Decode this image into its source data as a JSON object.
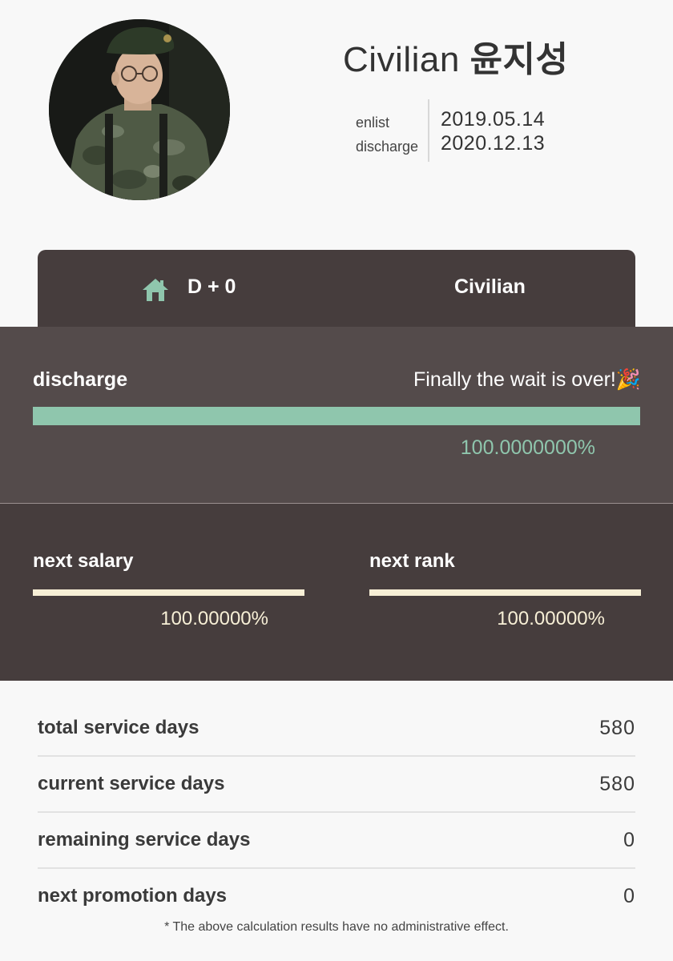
{
  "profile": {
    "name_prefix": "Civilian",
    "name_korean": "윤지성",
    "enlist_label": "enlist",
    "discharge_label": "discharge",
    "enlist_date": "2019.05.14",
    "discharge_date": "2020.12.13"
  },
  "dday": {
    "icon": "home-icon",
    "text": "D + 0",
    "status": "Civilian"
  },
  "discharge_progress": {
    "label": "discharge",
    "message": "Finally the wait is over!🎉",
    "percent_text": "100.0000000%",
    "fraction": 1.0
  },
  "next_salary": {
    "label": "next salary",
    "percent_text": "100.00000%",
    "fraction": 1.0
  },
  "next_rank": {
    "label": "next rank",
    "percent_text": "100.00000%",
    "fraction": 1.0
  },
  "stats": [
    {
      "label": "total service days",
      "value": "580"
    },
    {
      "label": "current service days",
      "value": "580"
    },
    {
      "label": "remaining service days",
      "value": "0"
    },
    {
      "label": "next promotion days",
      "value": "0"
    }
  ],
  "footnote": "* The above calculation results have no administrative effect.",
  "colors": {
    "accent_green": "#8fc6ad",
    "cream": "#f7efd6",
    "panel_dark": "#463d3d",
    "panel_mid": "#544b4b"
  }
}
